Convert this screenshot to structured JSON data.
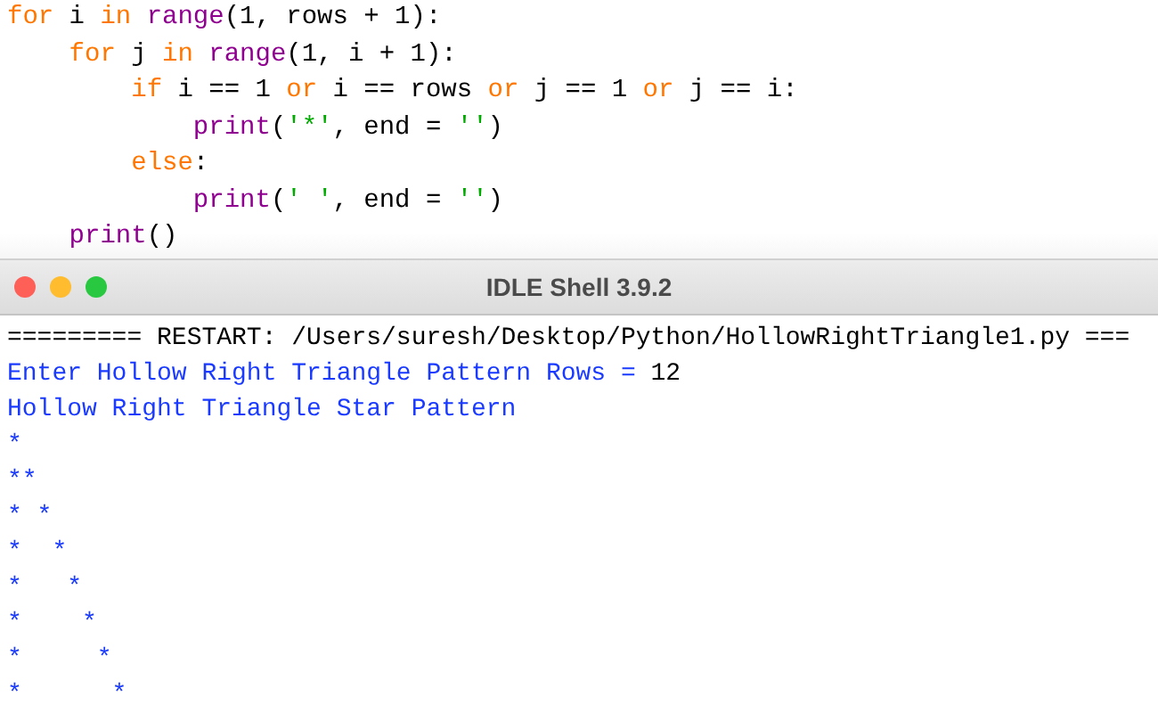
{
  "editor": {
    "lines": [
      [
        {
          "text": "for",
          "kind": "keyword"
        },
        {
          "text": " i ",
          "kind": "plain"
        },
        {
          "text": "in",
          "kind": "keyword"
        },
        {
          "text": " range",
          "kind": "builtin"
        },
        {
          "text": "(1, rows + 1):",
          "kind": "plain"
        }
      ],
      [
        {
          "text": "    for",
          "kind": "keyword"
        },
        {
          "text": " j ",
          "kind": "plain"
        },
        {
          "text": "in",
          "kind": "keyword"
        },
        {
          "text": " range",
          "kind": "builtin"
        },
        {
          "text": "(1, i + 1):",
          "kind": "plain"
        }
      ],
      [
        {
          "text": "        if",
          "kind": "keyword"
        },
        {
          "text": " i == 1 ",
          "kind": "plain"
        },
        {
          "text": "or",
          "kind": "keyword"
        },
        {
          "text": " i == rows ",
          "kind": "plain"
        },
        {
          "text": "or",
          "kind": "keyword"
        },
        {
          "text": " j == 1 ",
          "kind": "plain"
        },
        {
          "text": "or",
          "kind": "keyword"
        },
        {
          "text": " j == i:",
          "kind": "plain"
        }
      ],
      [
        {
          "text": "            print",
          "kind": "builtin"
        },
        {
          "text": "(",
          "kind": "plain"
        },
        {
          "text": "'*'",
          "kind": "string"
        },
        {
          "text": ", end = ",
          "kind": "plain"
        },
        {
          "text": "''",
          "kind": "string"
        },
        {
          "text": ")",
          "kind": "plain"
        }
      ],
      [
        {
          "text": "        else",
          "kind": "keyword"
        },
        {
          "text": ":",
          "kind": "plain"
        }
      ],
      [
        {
          "text": "            print",
          "kind": "builtin"
        },
        {
          "text": "(",
          "kind": "plain"
        },
        {
          "text": "' '",
          "kind": "string"
        },
        {
          "text": ", end = ",
          "kind": "plain"
        },
        {
          "text": "''",
          "kind": "string"
        },
        {
          "text": ")",
          "kind": "plain"
        }
      ],
      [
        {
          "text": "    print",
          "kind": "builtin"
        },
        {
          "text": "()",
          "kind": "plain"
        }
      ]
    ]
  },
  "shell": {
    "title": "IDLE Shell 3.9.2",
    "lines": [
      [
        {
          "text": "========= RESTART: /Users/suresh/Desktop/Python/HollowRightTriangle1.py ===",
          "kind": "plain"
        }
      ],
      [
        {
          "text": "Enter Hollow Right Triangle Pattern Rows = ",
          "kind": "output"
        },
        {
          "text": "12",
          "kind": "plain"
        }
      ],
      [
        {
          "text": "Hollow Right Triangle Star Pattern",
          "kind": "output"
        }
      ],
      [
        {
          "text": "*",
          "kind": "output"
        }
      ],
      [
        {
          "text": "**",
          "kind": "output"
        }
      ],
      [
        {
          "text": "* *",
          "kind": "output"
        }
      ],
      [
        {
          "text": "*  *",
          "kind": "output"
        }
      ],
      [
        {
          "text": "*   *",
          "kind": "output"
        }
      ],
      [
        {
          "text": "*    *",
          "kind": "output"
        }
      ],
      [
        {
          "text": "*     *",
          "kind": "output"
        }
      ],
      [
        {
          "text": "*      *",
          "kind": "output"
        }
      ]
    ]
  }
}
